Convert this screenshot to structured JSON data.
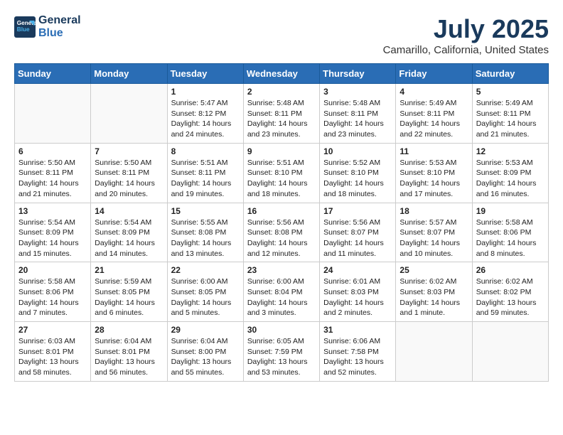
{
  "header": {
    "logo_line1": "General",
    "logo_line2": "Blue",
    "month": "July 2025",
    "location": "Camarillo, California, United States"
  },
  "weekdays": [
    "Sunday",
    "Monday",
    "Tuesday",
    "Wednesday",
    "Thursday",
    "Friday",
    "Saturday"
  ],
  "weeks": [
    [
      {
        "day": "",
        "info": ""
      },
      {
        "day": "",
        "info": ""
      },
      {
        "day": "1",
        "info": "Sunrise: 5:47 AM\nSunset: 8:12 PM\nDaylight: 14 hours\nand 24 minutes."
      },
      {
        "day": "2",
        "info": "Sunrise: 5:48 AM\nSunset: 8:11 PM\nDaylight: 14 hours\nand 23 minutes."
      },
      {
        "day": "3",
        "info": "Sunrise: 5:48 AM\nSunset: 8:11 PM\nDaylight: 14 hours\nand 23 minutes."
      },
      {
        "day": "4",
        "info": "Sunrise: 5:49 AM\nSunset: 8:11 PM\nDaylight: 14 hours\nand 22 minutes."
      },
      {
        "day": "5",
        "info": "Sunrise: 5:49 AM\nSunset: 8:11 PM\nDaylight: 14 hours\nand 21 minutes."
      }
    ],
    [
      {
        "day": "6",
        "info": "Sunrise: 5:50 AM\nSunset: 8:11 PM\nDaylight: 14 hours\nand 21 minutes."
      },
      {
        "day": "7",
        "info": "Sunrise: 5:50 AM\nSunset: 8:11 PM\nDaylight: 14 hours\nand 20 minutes."
      },
      {
        "day": "8",
        "info": "Sunrise: 5:51 AM\nSunset: 8:11 PM\nDaylight: 14 hours\nand 19 minutes."
      },
      {
        "day": "9",
        "info": "Sunrise: 5:51 AM\nSunset: 8:10 PM\nDaylight: 14 hours\nand 18 minutes."
      },
      {
        "day": "10",
        "info": "Sunrise: 5:52 AM\nSunset: 8:10 PM\nDaylight: 14 hours\nand 18 minutes."
      },
      {
        "day": "11",
        "info": "Sunrise: 5:53 AM\nSunset: 8:10 PM\nDaylight: 14 hours\nand 17 minutes."
      },
      {
        "day": "12",
        "info": "Sunrise: 5:53 AM\nSunset: 8:09 PM\nDaylight: 14 hours\nand 16 minutes."
      }
    ],
    [
      {
        "day": "13",
        "info": "Sunrise: 5:54 AM\nSunset: 8:09 PM\nDaylight: 14 hours\nand 15 minutes."
      },
      {
        "day": "14",
        "info": "Sunrise: 5:54 AM\nSunset: 8:09 PM\nDaylight: 14 hours\nand 14 minutes."
      },
      {
        "day": "15",
        "info": "Sunrise: 5:55 AM\nSunset: 8:08 PM\nDaylight: 14 hours\nand 13 minutes."
      },
      {
        "day": "16",
        "info": "Sunrise: 5:56 AM\nSunset: 8:08 PM\nDaylight: 14 hours\nand 12 minutes."
      },
      {
        "day": "17",
        "info": "Sunrise: 5:56 AM\nSunset: 8:07 PM\nDaylight: 14 hours\nand 11 minutes."
      },
      {
        "day": "18",
        "info": "Sunrise: 5:57 AM\nSunset: 8:07 PM\nDaylight: 14 hours\nand 10 minutes."
      },
      {
        "day": "19",
        "info": "Sunrise: 5:58 AM\nSunset: 8:06 PM\nDaylight: 14 hours\nand 8 minutes."
      }
    ],
    [
      {
        "day": "20",
        "info": "Sunrise: 5:58 AM\nSunset: 8:06 PM\nDaylight: 14 hours\nand 7 minutes."
      },
      {
        "day": "21",
        "info": "Sunrise: 5:59 AM\nSunset: 8:05 PM\nDaylight: 14 hours\nand 6 minutes."
      },
      {
        "day": "22",
        "info": "Sunrise: 6:00 AM\nSunset: 8:05 PM\nDaylight: 14 hours\nand 5 minutes."
      },
      {
        "day": "23",
        "info": "Sunrise: 6:00 AM\nSunset: 8:04 PM\nDaylight: 14 hours\nand 3 minutes."
      },
      {
        "day": "24",
        "info": "Sunrise: 6:01 AM\nSunset: 8:03 PM\nDaylight: 14 hours\nand 2 minutes."
      },
      {
        "day": "25",
        "info": "Sunrise: 6:02 AM\nSunset: 8:03 PM\nDaylight: 14 hours\nand 1 minute."
      },
      {
        "day": "26",
        "info": "Sunrise: 6:02 AM\nSunset: 8:02 PM\nDaylight: 13 hours\nand 59 minutes."
      }
    ],
    [
      {
        "day": "27",
        "info": "Sunrise: 6:03 AM\nSunset: 8:01 PM\nDaylight: 13 hours\nand 58 minutes."
      },
      {
        "day": "28",
        "info": "Sunrise: 6:04 AM\nSunset: 8:01 PM\nDaylight: 13 hours\nand 56 minutes."
      },
      {
        "day": "29",
        "info": "Sunrise: 6:04 AM\nSunset: 8:00 PM\nDaylight: 13 hours\nand 55 minutes."
      },
      {
        "day": "30",
        "info": "Sunrise: 6:05 AM\nSunset: 7:59 PM\nDaylight: 13 hours\nand 53 minutes."
      },
      {
        "day": "31",
        "info": "Sunrise: 6:06 AM\nSunset: 7:58 PM\nDaylight: 13 hours\nand 52 minutes."
      },
      {
        "day": "",
        "info": ""
      },
      {
        "day": "",
        "info": ""
      }
    ]
  ]
}
